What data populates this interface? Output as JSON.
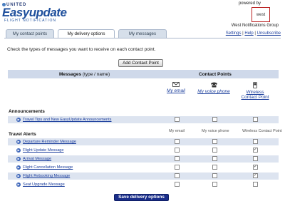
{
  "brand": {
    "united": "UNITED",
    "name": "Easyupdate",
    "subtitle": "FLIGHT NOTIFICATION",
    "powered_by": "powered by",
    "partner_box": "west",
    "partner": "West Notifications Group"
  },
  "tabs": [
    {
      "label": "My contact points",
      "active": false
    },
    {
      "label": "My delivery options",
      "active": true
    },
    {
      "label": "My messages",
      "active": false
    }
  ],
  "toplinks": {
    "settings": "Settings",
    "sep1": " | ",
    "help": "Help",
    "sep2": " | ",
    "unsubscribe": "Unsubscribe"
  },
  "instructions": "Check the types of messages you want to receive on each contact point.",
  "add_contact_button": "Add Contact Point",
  "table_header": {
    "messages": "Messages",
    "messages_sub": "(type / name)",
    "contact_points": "Contact Points"
  },
  "contact_points": [
    {
      "label": "My email",
      "icon": "envelope-icon"
    },
    {
      "label": "My voice phone",
      "icon": "phone-icon"
    },
    {
      "label_line1": "Wireless",
      "label_line2": "Contact Point",
      "icon": "mobile-icon"
    }
  ],
  "announcements": {
    "title": "Announcements",
    "rows": [
      {
        "label": "Travel Tips and New EasyUpdate Announcements",
        "email": false,
        "voice": false,
        "wireless": false
      }
    ]
  },
  "travel_alerts": {
    "title": "Travel Alerts",
    "col_email": "My email",
    "col_voice": "My voice phone",
    "col_wireless": "Wireless Contact Point",
    "rows": [
      {
        "label": "Departure Reminder Message",
        "email": false,
        "voice": false,
        "wireless": false
      },
      {
        "label": "Flight Update Message",
        "email": false,
        "voice": false,
        "wireless": true
      },
      {
        "label": "Arrival Message",
        "email": false,
        "voice": false,
        "wireless": false
      },
      {
        "label": "Flight Cancellation Message",
        "email": false,
        "voice": false,
        "wireless": true
      },
      {
        "label": "Flight Rebooking Message",
        "email": false,
        "voice": false,
        "wireless": true
      },
      {
        "label": "Seat Upgrade Message",
        "email": false,
        "voice": false,
        "wireless": false
      }
    ]
  },
  "save_button": "Save delivery options",
  "colors": {
    "accent": "#1a2e8a",
    "header_bar": "#cfd9ea",
    "link": "#1a3d9c",
    "row_alt": "#dde4f0"
  }
}
